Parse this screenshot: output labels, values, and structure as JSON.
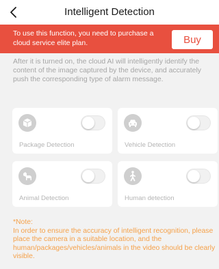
{
  "header": {
    "back_icon": "chevron-left-icon",
    "title": "Intelligent Detection"
  },
  "banner": {
    "text": "To use this function, you need to purchase a cloud service elite plan.",
    "buy_label": "Buy",
    "color": "#e8503f"
  },
  "description": "After it is turned on, the cloud AI will intelligently identify the content of the image captured by the device, and accurately push the corresponding type of alarm message.",
  "detections": [
    {
      "label": "Package Detection",
      "icon": "package-icon",
      "enabled": false
    },
    {
      "label": "Vehicle Detection",
      "icon": "car-icon",
      "enabled": false
    },
    {
      "label": "Animal Detection",
      "icon": "dog-icon",
      "enabled": false
    },
    {
      "label": "Human detection",
      "icon": "person-walking-icon",
      "enabled": false
    }
  ],
  "note": {
    "title": "*Note:",
    "text": "In order to ensure the accuracy of intelligent recognition, please place the camera in a suitable location, and the human/packages/vehicles/animals in the video should be clearly visible.",
    "color": "#f5a14a"
  }
}
